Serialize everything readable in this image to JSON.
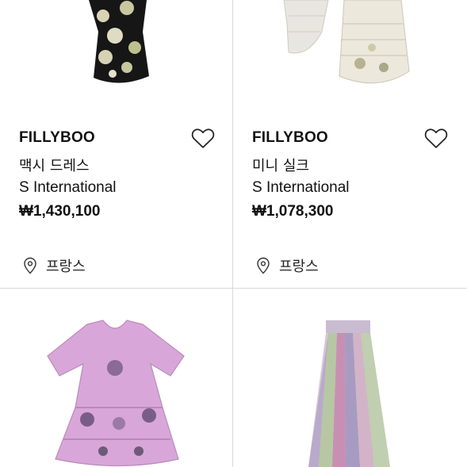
{
  "products": [
    {
      "brand": "FILLYBOO",
      "name": "맥시 드레스",
      "seller": "S International",
      "price": "₩1,430,100",
      "location": "프랑스"
    },
    {
      "brand": "FILLYBOO",
      "name": "미니 실크",
      "seller": "S International",
      "price": "₩1,078,300",
      "location": "프랑스"
    },
    {
      "brand": "",
      "name": "",
      "seller": "",
      "price": "",
      "location": ""
    },
    {
      "brand": "",
      "name": "",
      "seller": "",
      "price": "",
      "location": ""
    }
  ],
  "icons": {
    "favorite": "heart-outline-icon",
    "location": "map-pin-icon"
  }
}
